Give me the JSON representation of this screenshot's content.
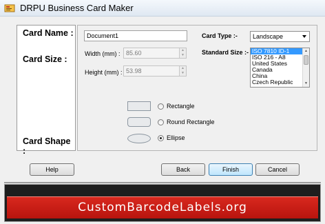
{
  "window": {
    "title": "DRPU Business Card Maker",
    "icon": "app-card-icon"
  },
  "side_labels": {
    "card_name": "Card Name :",
    "card_size": "Card Size :",
    "card_shape": "Card Shape :"
  },
  "card_name": {
    "value": "Document1"
  },
  "size": {
    "width_label": "Width (mm) :",
    "width_value": "85.60",
    "height_label": "Height (mm) :",
    "height_value": "53.98"
  },
  "card_type": {
    "label": "Card Type :-",
    "selected": "Landscape"
  },
  "standard_size": {
    "label": "Standard Size :-",
    "options": [
      "ISO 7810 ID-1",
      "ISO 216 - A8",
      "United States",
      "Canada",
      "China",
      "Czech Republic"
    ],
    "selected_index": 0
  },
  "shapes": {
    "options": [
      "Rectangle",
      "Round Rectangle",
      "Ellipse"
    ],
    "selected": "Ellipse"
  },
  "buttons": {
    "help": "Help",
    "back": "Back",
    "finish": "Finish",
    "cancel": "Cancel"
  },
  "banner": {
    "text": "CustomBarcodeLabels.org"
  },
  "colors": {
    "banner_red": "#c81e14",
    "selection_blue": "#3399ff"
  }
}
